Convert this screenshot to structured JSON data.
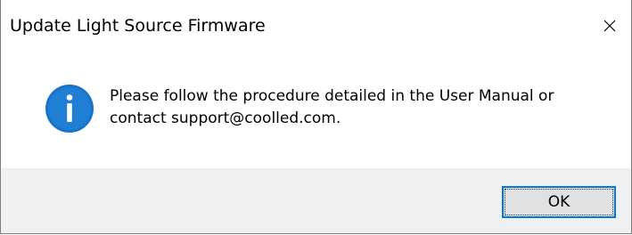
{
  "dialog": {
    "title": "Update Light Source Firmware",
    "close_icon": "close-icon",
    "info_icon": "info-icon",
    "message_line1": "Please follow the procedure detailed in the User Manual or",
    "message_line2": "contact support@coolled.com.",
    "ok_label": "OK"
  },
  "colors": {
    "info_blue": "#1a73c9",
    "footer_bg": "#f0f0f0",
    "button_focus_border": "#0078d7"
  }
}
